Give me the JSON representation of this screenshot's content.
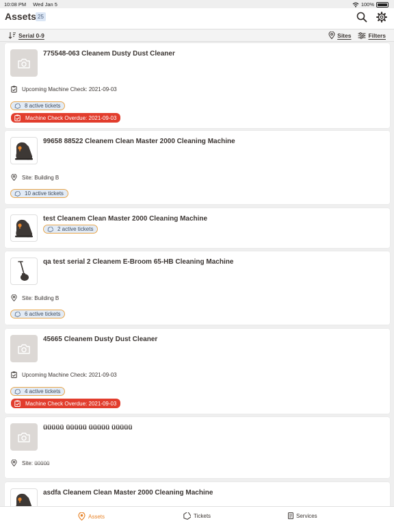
{
  "status_bar": {
    "time": "10:08 PM",
    "date": "Wed Jan 5",
    "battery": "100%"
  },
  "header": {
    "title": "Assets",
    "count": "25"
  },
  "toolbar": {
    "sort_label": "Serial 0-9",
    "sites_label": "Sites",
    "filters_label": "Filters"
  },
  "assets": [
    {
      "title": "775548-063 Cleanem Dusty Dust Cleaner",
      "info": "Upcoming Machine Check: 2021-09-03",
      "tickets": "8 active tickets",
      "alert": "Machine Check Overdue: 2021-09-03"
    },
    {
      "title": "99658 88522 Cleanem Clean Master 2000 Cleaning Machine",
      "info": "Site: Building B",
      "tickets": "10 active tickets"
    },
    {
      "title": "test Cleanem Clean Master 2000 Cleaning Machine",
      "tickets": "2 active tickets"
    },
    {
      "title": "qa test serial 2 Cleanem E-Broom 65-HB Cleaning Machine",
      "info": "Site: Building B",
      "tickets": "6 active tickets"
    },
    {
      "title": "45665 Cleanem Dusty Dust Cleaner",
      "info": "Upcoming Machine Check: 2021-09-03",
      "tickets": "4 active tickets",
      "alert": "Machine Check Overdue: 2021-09-03"
    },
    {
      "title": "üüüüü üüüüü üüüüü üüüüü",
      "info": "Site: üüüüü"
    },
    {
      "title": "asdfa Cleanem Clean Master 2000 Cleaning Machine"
    }
  ],
  "tabs": [
    {
      "label": "Assets"
    },
    {
      "label": "Tickets"
    },
    {
      "label": "Services"
    }
  ],
  "colors": {
    "accent": "#e8852b",
    "alert": "#e23d2d",
    "pill_bg": "#e2ebf6",
    "pill_border": "#e8a64c"
  }
}
